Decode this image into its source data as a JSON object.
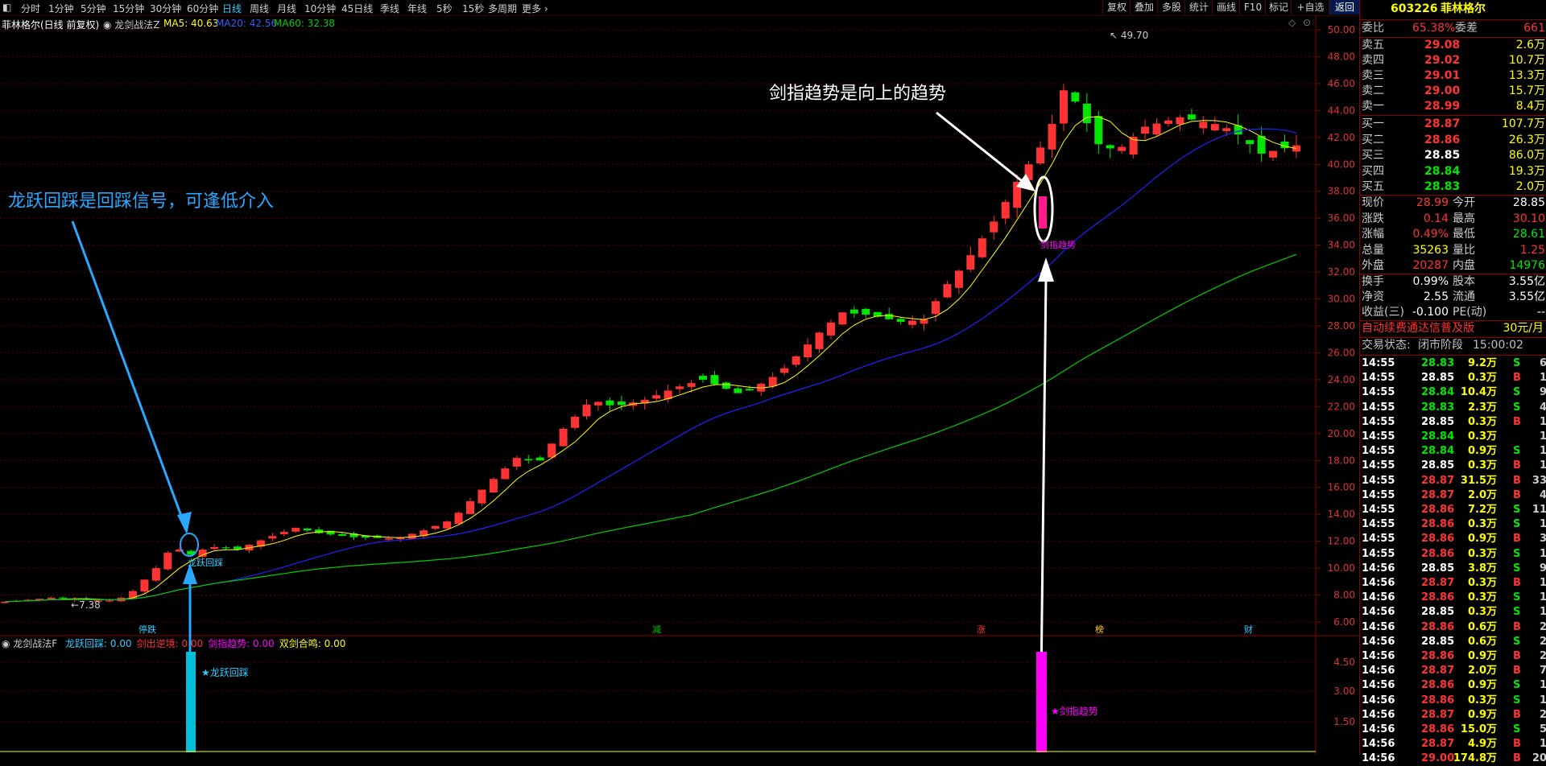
{
  "toolbar": {
    "left_icon": "◧",
    "periods": [
      "分时",
      "1分钟",
      "5分钟",
      "15分钟",
      "30分钟",
      "60分钟",
      "日线",
      "周线",
      "月线",
      "10分钟",
      "45日线",
      "季线",
      "年线",
      "5秒",
      "15秒",
      "多周期",
      "更多 ›"
    ],
    "active_period": "日线",
    "right_buttons": [
      "复权",
      "叠加",
      "多股",
      "统计",
      "画线",
      "F10",
      "标记",
      "+自选",
      "返回"
    ]
  },
  "main_chart": {
    "title": "菲林格尔(日线 前复权)",
    "indicator": "龙剑战法Z",
    "ma5": "MA5: 40.63",
    "ma20": "MA20: 42.56",
    "ma60": "MA60: 32.38",
    "high_label": "49.70",
    "low_label": "7.38",
    "y_ticks": [
      "50.00",
      "48.00",
      "46.00",
      "44.00",
      "42.00",
      "40.00",
      "38.00",
      "36.00",
      "34.00",
      "32.00",
      "30.00",
      "28.00",
      "26.00",
      "24.00",
      "22.00",
      "20.00",
      "18.00",
      "16.00",
      "14.00",
      "12.00",
      "10.00",
      "8.00",
      "6.00"
    ],
    "bottom_markers": [
      {
        "label": "停跌",
        "color": "#3cf"
      },
      {
        "label": "减",
        "color": "#0c0"
      },
      {
        "label": "涨",
        "color": "#f33"
      },
      {
        "label": "榜",
        "color": "#fc0"
      },
      {
        "label": "财",
        "color": "#3cf"
      }
    ],
    "signal_dragon": "龙跃回踩",
    "signal_sword": "剑指趋势"
  },
  "annotations": {
    "left_text": "龙跃回踩是回踩信号，可逢低介入",
    "right_text": "剑指趋势是向上的趋势"
  },
  "sub_chart": {
    "indicator": "龙剑战法F",
    "legend": [
      {
        "text": "龙跃回踩: 0.00",
        "color": "#3cf"
      },
      {
        "text": "剑出逆境: 0.00",
        "color": "#f33"
      },
      {
        "text": "剑指趋势: 0.00",
        "color": "#f0f"
      },
      {
        "text": "双剑合鸣: 0.00",
        "color": "#ff0"
      }
    ],
    "y_ticks": [
      "4.50",
      "3.00",
      "1.50"
    ],
    "bar1_label": "★龙跃回踩",
    "bar2_label": "★剑指趋势"
  },
  "quote": {
    "code": "603226",
    "name": "菲林格尔",
    "weibi_label": "委比",
    "weibi_value": "65.38%",
    "weicha_label": "委差",
    "weicha_value": "661",
    "asks": [
      {
        "label": "卖五",
        "price": "29.08",
        "vol": "2.6万"
      },
      {
        "label": "卖四",
        "price": "29.02",
        "vol": "10.7万"
      },
      {
        "label": "卖三",
        "price": "29.01",
        "vol": "13.3万"
      },
      {
        "label": "卖二",
        "price": "29.00",
        "vol": "15.7万"
      },
      {
        "label": "卖一",
        "price": "28.99",
        "vol": "8.4万"
      }
    ],
    "bids": [
      {
        "label": "买一",
        "price": "28.87",
        "vol": "107.7万"
      },
      {
        "label": "买二",
        "price": "28.86",
        "vol": "26.3万"
      },
      {
        "label": "买三",
        "price": "28.85",
        "vol": "86.0万"
      },
      {
        "label": "买四",
        "price": "28.84",
        "vol": "19.3万"
      },
      {
        "label": "买五",
        "price": "28.83",
        "vol": "2.0万"
      }
    ],
    "stats": [
      {
        "l1": "现价",
        "v1": "28.99",
        "l2": "今开",
        "v2": "28.85"
      },
      {
        "l1": "涨跌",
        "v1": "0.14",
        "l2": "最高",
        "v2": "30.10"
      },
      {
        "l1": "涨幅",
        "v1": "0.49%",
        "l2": "最低",
        "v2": "28.61"
      },
      {
        "l1": "总量",
        "v1": "35263",
        "l2": "量比",
        "v2": "1.25"
      },
      {
        "l1": "外盘",
        "v1": "20287",
        "l2": "内盘",
        "v2": "14976"
      }
    ],
    "stats2": [
      {
        "l1": "换手",
        "v1": "0.99%",
        "l2": "股本",
        "v2": "3.55亿"
      },
      {
        "l1": "净资",
        "v1": "2.55",
        "l2": "流通",
        "v2": "3.55亿"
      },
      {
        "l1": "收益(三)",
        "v1": "-0.100",
        "l2": "PE(动)",
        "v2": "--"
      }
    ],
    "promo": "自动续费通达信普及版",
    "promo_price": "30元/月",
    "status_label": "交易状态:",
    "status_value": "闭市阶段",
    "status_time": "15:00:02"
  },
  "trades": [
    {
      "t": "14:55",
      "p": "28.83",
      "v": "9.2万",
      "s": "S",
      "n": "6"
    },
    {
      "t": "14:55",
      "p": "28.85",
      "v": "0.3万",
      "s": "B",
      "n": "1"
    },
    {
      "t": "14:55",
      "p": "28.84",
      "v": "10.4万",
      "s": "S",
      "n": "9"
    },
    {
      "t": "14:55",
      "p": "28.83",
      "v": "2.3万",
      "s": "S",
      "n": "4"
    },
    {
      "t": "14:55",
      "p": "28.85",
      "v": "0.3万",
      "s": "B",
      "n": "1"
    },
    {
      "t": "14:55",
      "p": "28.84",
      "v": "0.3万",
      "s": "",
      "n": "1"
    },
    {
      "t": "14:55",
      "p": "28.84",
      "v": "0.9万",
      "s": "S",
      "n": "1"
    },
    {
      "t": "14:55",
      "p": "28.85",
      "v": "0.3万",
      "s": "B",
      "n": "1"
    },
    {
      "t": "14:55",
      "p": "28.87",
      "v": "31.5万",
      "s": "B",
      "n": "33"
    },
    {
      "t": "14:55",
      "p": "28.87",
      "v": "2.0万",
      "s": "B",
      "n": "4"
    },
    {
      "t": "14:55",
      "p": "28.86",
      "v": "7.2万",
      "s": "S",
      "n": "11"
    },
    {
      "t": "14:55",
      "p": "28.86",
      "v": "0.3万",
      "s": "S",
      "n": "1"
    },
    {
      "t": "14:55",
      "p": "28.86",
      "v": "0.9万",
      "s": "B",
      "n": "3"
    },
    {
      "t": "14:55",
      "p": "28.86",
      "v": "0.3万",
      "s": "S",
      "n": "1"
    },
    {
      "t": "14:56",
      "p": "28.85",
      "v": "3.8万",
      "s": "S",
      "n": "9"
    },
    {
      "t": "14:56",
      "p": "28.87",
      "v": "0.3万",
      "s": "B",
      "n": "1"
    },
    {
      "t": "14:56",
      "p": "28.86",
      "v": "0.3万",
      "s": "S",
      "n": "1"
    },
    {
      "t": "14:56",
      "p": "28.85",
      "v": "0.3万",
      "s": "S",
      "n": "1"
    },
    {
      "t": "14:56",
      "p": "28.86",
      "v": "0.6万",
      "s": "B",
      "n": "2"
    },
    {
      "t": "14:56",
      "p": "28.85",
      "v": "0.6万",
      "s": "S",
      "n": "2"
    },
    {
      "t": "14:56",
      "p": "28.86",
      "v": "0.9万",
      "s": "B",
      "n": "2"
    },
    {
      "t": "14:56",
      "p": "28.87",
      "v": "2.0万",
      "s": "B",
      "n": "7"
    },
    {
      "t": "14:56",
      "p": "28.86",
      "v": "0.9万",
      "s": "S",
      "n": "1"
    },
    {
      "t": "14:56",
      "p": "28.86",
      "v": "0.3万",
      "s": "S",
      "n": "1"
    },
    {
      "t": "14:56",
      "p": "28.87",
      "v": "0.9万",
      "s": "B",
      "n": "2"
    },
    {
      "t": "14:56",
      "p": "28.86",
      "v": "15.0万",
      "s": "S",
      "n": "5"
    },
    {
      "t": "14:56",
      "p": "28.87",
      "v": "4.9万",
      "s": "B",
      "n": "1"
    },
    {
      "t": "14:56",
      "p": "29.00",
      "v": "174.8万",
      "s": "B",
      "n": "20"
    }
  ],
  "colors": {
    "up": "#ff3333",
    "down": "#00e600",
    "flat": "#ffffff",
    "ma5": "#ffff00",
    "ma20": "#2020ff",
    "ma60": "#00cc00",
    "grid": "#5a0000",
    "accent": "#33ccff",
    "magenta": "#ff00ff"
  }
}
